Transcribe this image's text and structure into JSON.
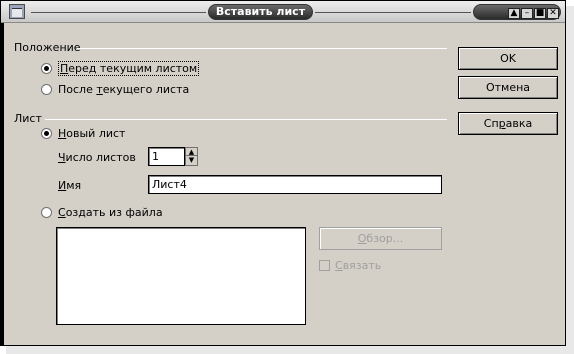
{
  "window": {
    "title": "Вставить лист",
    "controls": [
      "roll-up",
      "minimize",
      "maximize",
      "close"
    ]
  },
  "position_group": {
    "label": "Положение",
    "options": [
      {
        "pre": "",
        "mnemonic": "П",
        "post": "еред текущим листом",
        "checked": true
      },
      {
        "pre": "После ",
        "mnemonic": "т",
        "post": "екущего листа",
        "checked": false
      }
    ]
  },
  "sheet_group": {
    "label": "Лист",
    "new_sheet": {
      "pre": "",
      "mnemonic": "Н",
      "post": "овый лист",
      "checked": true
    },
    "count_label": {
      "mnemonic": "Ч",
      "post": "исло листов"
    },
    "count_value": "1",
    "name_label": {
      "mnemonic": "И",
      "post": "мя"
    },
    "name_value": "Лист4",
    "from_file": {
      "pre": "",
      "mnemonic": "С",
      "post": "оздать из файла",
      "checked": false
    },
    "browse_button": {
      "mnemonic": "О",
      "post": "бзор..."
    },
    "link_checkbox": {
      "mnemonic": "С",
      "post": "вязать",
      "checked": false
    }
  },
  "buttons": {
    "ok": "OK",
    "cancel": "Отмена",
    "help": {
      "pre": "Сп",
      "mnemonic": "р",
      "post": "авка"
    }
  }
}
